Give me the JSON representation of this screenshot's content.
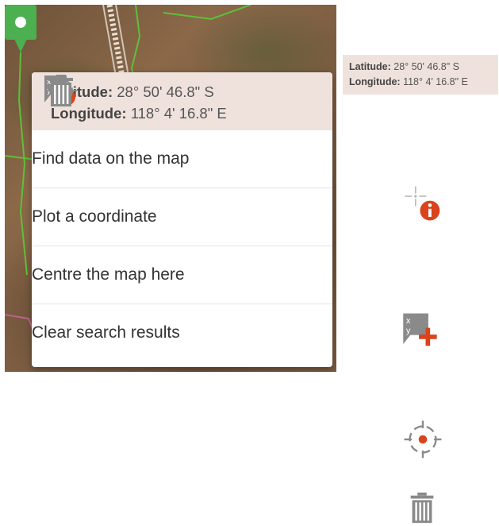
{
  "popup": {
    "latitude_label": "Latitude:",
    "latitude_value": "28° 50' 46.8\" S",
    "longitude_label": "Longitude:",
    "longitude_value": "118° 4' 16.8\" E",
    "items": [
      {
        "label": "Find data on the map",
        "icon": "find-data-icon"
      },
      {
        "label": "Plot a coordinate",
        "icon": "plot-coordinate-icon"
      },
      {
        "label": "Centre the map here",
        "icon": "crosshair-icon"
      },
      {
        "label": "Clear search results",
        "icon": "trash-icon"
      }
    ]
  },
  "coord_box": {
    "latitude_label": "Latitude:",
    "latitude_value": "28° 50' 46.8\" S",
    "longitude_label": "Longitude:",
    "longitude_value": "118° 4' 16.8\" E"
  },
  "colors": {
    "accent_red": "#d9441c",
    "pin_green": "#4caf50",
    "header_bg": "#efe2dd",
    "icon_gray": "#8a8a8a"
  }
}
